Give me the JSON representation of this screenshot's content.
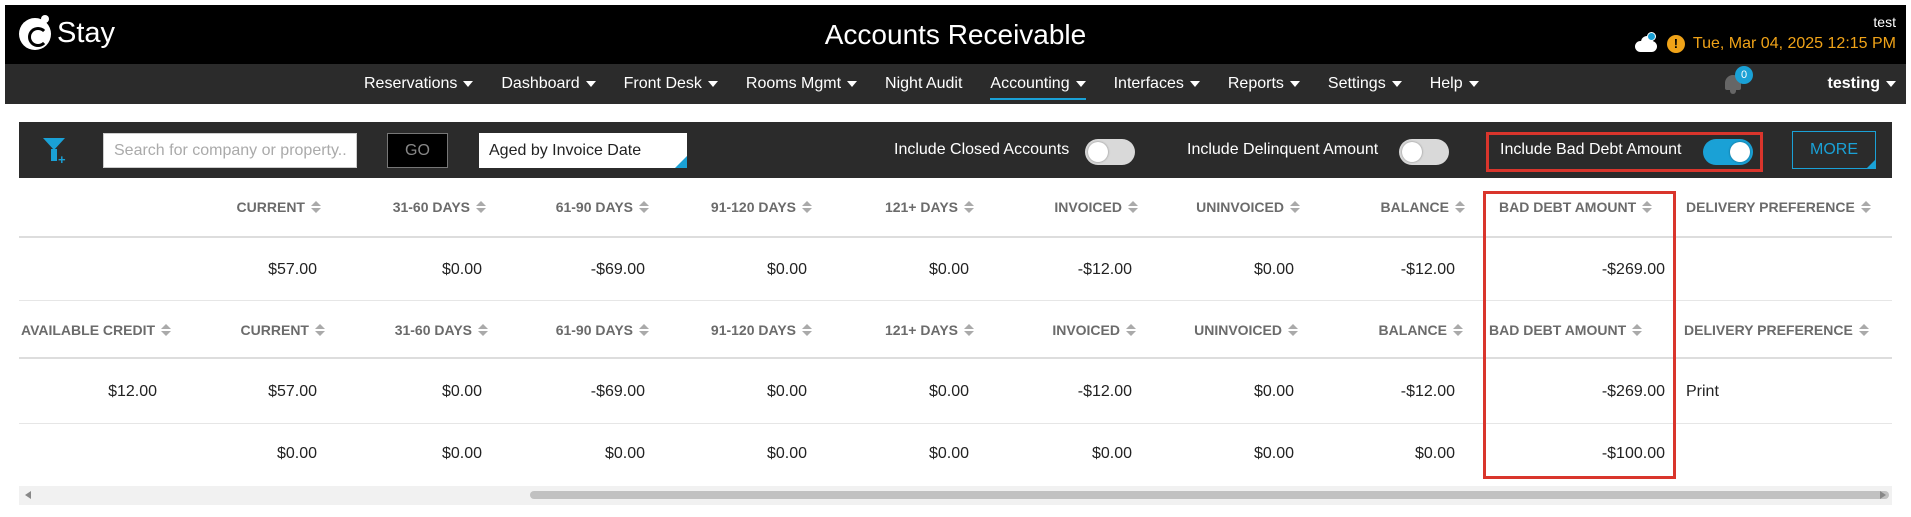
{
  "header": {
    "logo_text": "Stay",
    "title": "Accounts Receivable",
    "user": "test",
    "datetime": "Tue, Mar 04, 2025 12:15 PM",
    "accent": "#f0a318",
    "warning_symbol": "!"
  },
  "nav": {
    "items": [
      {
        "label": "Reservations",
        "dropdown": true
      },
      {
        "label": "Dashboard",
        "dropdown": true
      },
      {
        "label": "Front Desk",
        "dropdown": true
      },
      {
        "label": "Rooms Mgmt",
        "dropdown": true
      },
      {
        "label": "Night Audit",
        "dropdown": false
      },
      {
        "label": "Accounting",
        "dropdown": true,
        "active": true
      },
      {
        "label": "Interfaces",
        "dropdown": true
      },
      {
        "label": "Reports",
        "dropdown": true
      },
      {
        "label": "Settings",
        "dropdown": true
      },
      {
        "label": "Help",
        "dropdown": true
      }
    ],
    "notification_count": "0",
    "user": "testing"
  },
  "filters": {
    "search_placeholder": "Search for company or property...",
    "go_label": "GO",
    "aged_by": "Aged by Invoice Date",
    "include_closed_label": "Include Closed Accounts",
    "include_closed_on": false,
    "include_delinquent_label": "Include Delinquent Amount",
    "include_delinquent_on": false,
    "include_bad_debt_label": "Include Bad Debt Amount",
    "include_bad_debt_on": true,
    "more_label": "MORE"
  },
  "table": {
    "summary_header": [
      "CURRENT",
      "31-60 DAYS",
      "61-90 DAYS",
      "91-120 DAYS",
      "121+ DAYS",
      "INVOICED",
      "UNINVOICED",
      "BALANCE",
      "BAD DEBT AMOUNT",
      "DELIVERY PREFERENCE"
    ],
    "summary_row": [
      "$57.00",
      "$0.00",
      "-$69.00",
      "$0.00",
      "$0.00",
      "-$12.00",
      "$0.00",
      "-$12.00",
      "-$269.00",
      ""
    ],
    "detail_header": [
      "AVAILABLE CREDIT",
      "CURRENT",
      "31-60 DAYS",
      "61-90 DAYS",
      "91-120 DAYS",
      "121+ DAYS",
      "INVOICED",
      "UNINVOICED",
      "BALANCE",
      "BAD DEBT AMOUNT",
      "DELIVERY PREFERENCE"
    ],
    "detail_rows": [
      [
        "$12.00",
        "$57.00",
        "$0.00",
        "-$69.00",
        "$0.00",
        "$0.00",
        "-$12.00",
        "$0.00",
        "-$12.00",
        "-$269.00",
        "Print"
      ],
      [
        "",
        "$0.00",
        "$0.00",
        "$0.00",
        "$0.00",
        "$0.00",
        "$0.00",
        "$0.00",
        "$0.00",
        "-$100.00",
        ""
      ]
    ]
  },
  "colors": {
    "highlight": "#d9352c",
    "accent_blue": "#1aa1d6"
  }
}
